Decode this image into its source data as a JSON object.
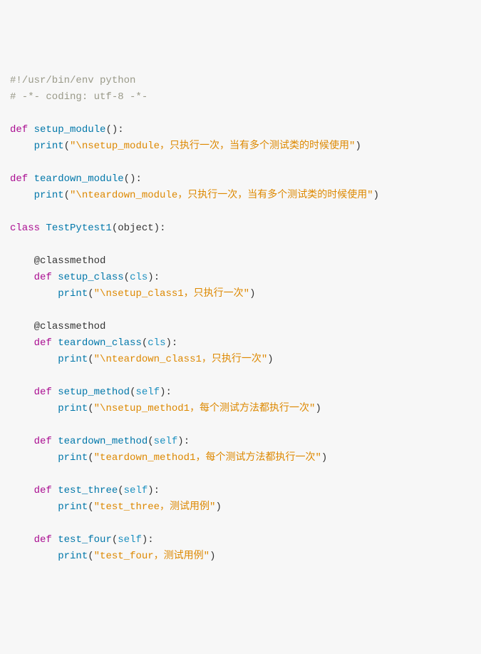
{
  "code": {
    "lines": [
      [
        {
          "cls": "c",
          "t": "#!/usr/bin/env python"
        }
      ],
      [
        {
          "cls": "c",
          "t": "# -*- coding: utf-8 -*-"
        }
      ],
      [],
      [
        {
          "cls": "kw",
          "t": "def"
        },
        {
          "cls": "pn",
          "t": " "
        },
        {
          "cls": "fn",
          "t": "setup_module"
        },
        {
          "cls": "pn",
          "t": "("
        },
        {
          "cls": "pn",
          "t": ")"
        },
        {
          "cls": "pn",
          "t": ":"
        }
      ],
      [
        {
          "cls": "pn",
          "t": "    "
        },
        {
          "cls": "bi",
          "t": "print"
        },
        {
          "cls": "pn",
          "t": "("
        },
        {
          "cls": "st",
          "t": "\"\\nsetup_module，只执行一次，当有多个测试类的时候使用\""
        },
        {
          "cls": "pn",
          "t": ")"
        }
      ],
      [],
      [
        {
          "cls": "kw",
          "t": "def"
        },
        {
          "cls": "pn",
          "t": " "
        },
        {
          "cls": "fn",
          "t": "teardown_module"
        },
        {
          "cls": "pn",
          "t": "("
        },
        {
          "cls": "pn",
          "t": ")"
        },
        {
          "cls": "pn",
          "t": ":"
        }
      ],
      [
        {
          "cls": "pn",
          "t": "    "
        },
        {
          "cls": "bi",
          "t": "print"
        },
        {
          "cls": "pn",
          "t": "("
        },
        {
          "cls": "st",
          "t": "\"\\nteardown_module，只执行一次，当有多个测试类的时候使用\""
        },
        {
          "cls": "pn",
          "t": ")"
        }
      ],
      [],
      [
        {
          "cls": "kw",
          "t": "class"
        },
        {
          "cls": "pn",
          "t": " "
        },
        {
          "cls": "fn",
          "t": "TestPytest1"
        },
        {
          "cls": "pn",
          "t": "("
        },
        {
          "cls": "nm",
          "t": "object"
        },
        {
          "cls": "pn",
          "t": ")"
        },
        {
          "cls": "pn",
          "t": ":"
        }
      ],
      [],
      [
        {
          "cls": "pn",
          "t": "    "
        },
        {
          "cls": "dc",
          "t": "@classmethod"
        }
      ],
      [
        {
          "cls": "pn",
          "t": "    "
        },
        {
          "cls": "kw",
          "t": "def"
        },
        {
          "cls": "pn",
          "t": " "
        },
        {
          "cls": "fn",
          "t": "setup_class"
        },
        {
          "cls": "pn",
          "t": "("
        },
        {
          "cls": "ar",
          "t": "cls"
        },
        {
          "cls": "pn",
          "t": ")"
        },
        {
          "cls": "pn",
          "t": ":"
        }
      ],
      [
        {
          "cls": "pn",
          "t": "        "
        },
        {
          "cls": "bi",
          "t": "print"
        },
        {
          "cls": "pn",
          "t": "("
        },
        {
          "cls": "st",
          "t": "\"\\nsetup_class1，只执行一次\""
        },
        {
          "cls": "pn",
          "t": ")"
        }
      ],
      [],
      [
        {
          "cls": "pn",
          "t": "    "
        },
        {
          "cls": "dc",
          "t": "@classmethod"
        }
      ],
      [
        {
          "cls": "pn",
          "t": "    "
        },
        {
          "cls": "kw",
          "t": "def"
        },
        {
          "cls": "pn",
          "t": " "
        },
        {
          "cls": "fn",
          "t": "teardown_class"
        },
        {
          "cls": "pn",
          "t": "("
        },
        {
          "cls": "ar",
          "t": "cls"
        },
        {
          "cls": "pn",
          "t": ")"
        },
        {
          "cls": "pn",
          "t": ":"
        }
      ],
      [
        {
          "cls": "pn",
          "t": "        "
        },
        {
          "cls": "bi",
          "t": "print"
        },
        {
          "cls": "pn",
          "t": "("
        },
        {
          "cls": "st",
          "t": "\"\\nteardown_class1，只执行一次\""
        },
        {
          "cls": "pn",
          "t": ")"
        }
      ],
      [],
      [
        {
          "cls": "pn",
          "t": "    "
        },
        {
          "cls": "kw",
          "t": "def"
        },
        {
          "cls": "pn",
          "t": " "
        },
        {
          "cls": "fn",
          "t": "setup_method"
        },
        {
          "cls": "pn",
          "t": "("
        },
        {
          "cls": "ar",
          "t": "self"
        },
        {
          "cls": "pn",
          "t": ")"
        },
        {
          "cls": "pn",
          "t": ":"
        }
      ],
      [
        {
          "cls": "pn",
          "t": "        "
        },
        {
          "cls": "bi",
          "t": "print"
        },
        {
          "cls": "pn",
          "t": "("
        },
        {
          "cls": "st",
          "t": "\"\\nsetup_method1，每个测试方法都执行一次\""
        },
        {
          "cls": "pn",
          "t": ")"
        }
      ],
      [],
      [
        {
          "cls": "pn",
          "t": "    "
        },
        {
          "cls": "kw",
          "t": "def"
        },
        {
          "cls": "pn",
          "t": " "
        },
        {
          "cls": "fn",
          "t": "teardown_method"
        },
        {
          "cls": "pn",
          "t": "("
        },
        {
          "cls": "ar",
          "t": "self"
        },
        {
          "cls": "pn",
          "t": ")"
        },
        {
          "cls": "pn",
          "t": ":"
        }
      ],
      [
        {
          "cls": "pn",
          "t": "        "
        },
        {
          "cls": "bi",
          "t": "print"
        },
        {
          "cls": "pn",
          "t": "("
        },
        {
          "cls": "st",
          "t": "\"teardown_method1，每个测试方法都执行一次\""
        },
        {
          "cls": "pn",
          "t": ")"
        }
      ],
      [],
      [
        {
          "cls": "pn",
          "t": "    "
        },
        {
          "cls": "kw",
          "t": "def"
        },
        {
          "cls": "pn",
          "t": " "
        },
        {
          "cls": "fn",
          "t": "test_three"
        },
        {
          "cls": "pn",
          "t": "("
        },
        {
          "cls": "ar",
          "t": "self"
        },
        {
          "cls": "pn",
          "t": ")"
        },
        {
          "cls": "pn",
          "t": ":"
        }
      ],
      [
        {
          "cls": "pn",
          "t": "        "
        },
        {
          "cls": "bi",
          "t": "print"
        },
        {
          "cls": "pn",
          "t": "("
        },
        {
          "cls": "st",
          "t": "\"test_three，测试用例\""
        },
        {
          "cls": "pn",
          "t": ")"
        }
      ],
      [],
      [
        {
          "cls": "pn",
          "t": "    "
        },
        {
          "cls": "kw",
          "t": "def"
        },
        {
          "cls": "pn",
          "t": " "
        },
        {
          "cls": "fn",
          "t": "test_four"
        },
        {
          "cls": "pn",
          "t": "("
        },
        {
          "cls": "ar",
          "t": "self"
        },
        {
          "cls": "pn",
          "t": ")"
        },
        {
          "cls": "pn",
          "t": ":"
        }
      ],
      [
        {
          "cls": "pn",
          "t": "        "
        },
        {
          "cls": "bi",
          "t": "print"
        },
        {
          "cls": "pn",
          "t": "("
        },
        {
          "cls": "st",
          "t": "\"test_four，测试用例\""
        },
        {
          "cls": "pn",
          "t": ")"
        }
      ]
    ]
  }
}
